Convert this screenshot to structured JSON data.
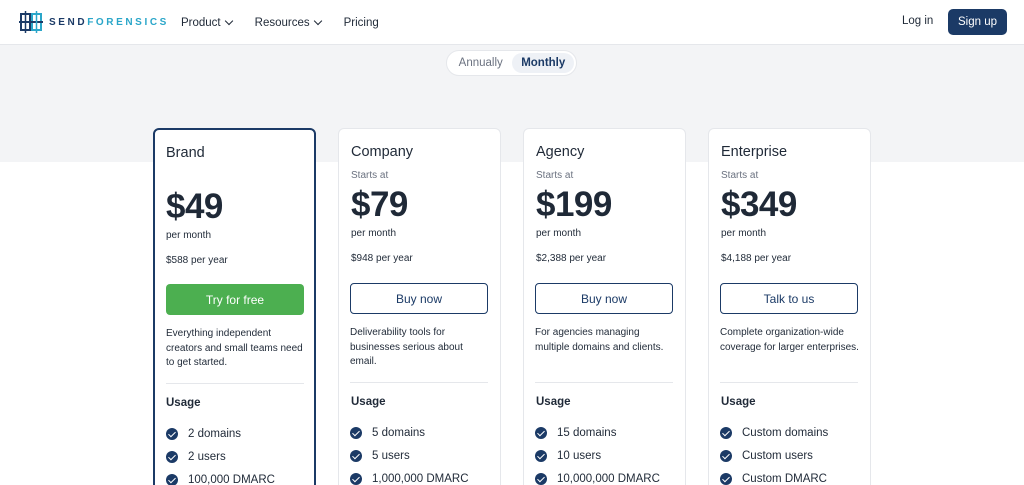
{
  "header": {
    "logo_prefix": "SEND",
    "logo_suffix": "FORENSICS",
    "nav": [
      {
        "label": "Product"
      },
      {
        "label": "Resources"
      },
      {
        "label": "Pricing"
      }
    ],
    "login": "Log in",
    "signup": "Sign up"
  },
  "billing_toggle": {
    "annual": "Annually",
    "monthly": "Monthly",
    "selected": "Monthly"
  },
  "colors": {
    "brand": "#1b3a66",
    "cta_green": "#4caf50"
  },
  "plans": [
    {
      "name": "Brand",
      "starts_at": "",
      "price": "$49",
      "per_month": "per month",
      "per_year": "$588 per year",
      "cta": "Try for free",
      "description": "Everything independent creators and small teams need to get started.",
      "usage_title": "Usage",
      "features": [
        "2 domains",
        "2 users",
        "100,000 DMARC"
      ]
    },
    {
      "name": "Company",
      "starts_at": "Starts at",
      "price": "$79",
      "per_month": "per month",
      "per_year": "$948 per year",
      "cta": "Buy now",
      "description": "Deliverability tools for businesses serious about email.",
      "usage_title": "Usage",
      "features": [
        "5 domains",
        "5 users",
        "1,000,000 DMARC"
      ]
    },
    {
      "name": "Agency",
      "starts_at": "Starts at",
      "price": "$199",
      "per_month": "per month",
      "per_year": "$2,388 per year",
      "cta": "Buy now",
      "description": "For agencies managing multiple domains and clients.",
      "usage_title": "Usage",
      "features": [
        "15 domains",
        "10 users",
        "10,000,000 DMARC"
      ]
    },
    {
      "name": "Enterprise",
      "starts_at": "Starts at",
      "price": "$349",
      "per_month": "per month",
      "per_year": "$4,188 per year",
      "cta": "Talk to us",
      "description": "Complete organization-wide coverage for larger enterprises.",
      "usage_title": "Usage",
      "features": [
        "Custom domains",
        "Custom users",
        "Custom DMARC"
      ]
    }
  ]
}
